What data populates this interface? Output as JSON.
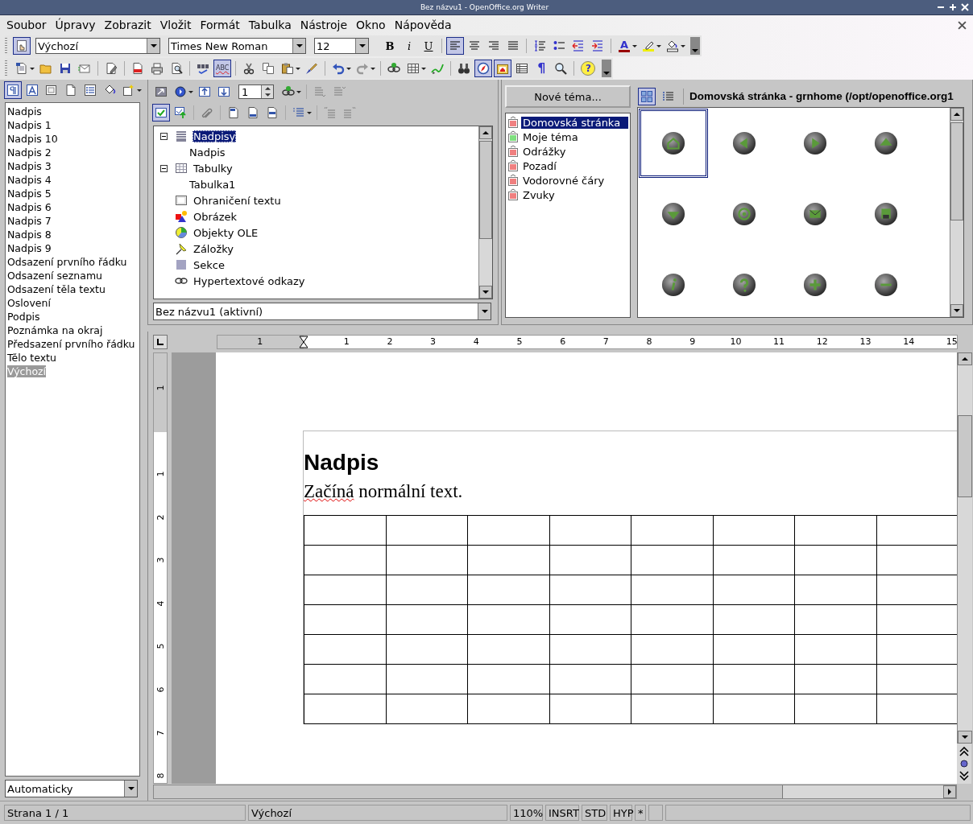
{
  "window": {
    "title": "Bez názvu1 - OpenOffice.org Writer"
  },
  "menu": [
    "Soubor",
    "Úpravy",
    "Zobrazit",
    "Vložit",
    "Formát",
    "Tabulka",
    "Nástroje",
    "Okno",
    "Nápověda"
  ],
  "formatting_toolbar": {
    "stylist": {
      "on": true
    },
    "style": "Výchozí",
    "font": "Times New Roman",
    "size": "12",
    "items": [
      {
        "kind": "bold",
        "label": "B",
        "on": false
      },
      {
        "kind": "italic",
        "label": "i",
        "on": false
      },
      {
        "kind": "underline",
        "label": "U",
        "on": false
      },
      {
        "kind": "separator"
      },
      {
        "kind": "align-left",
        "on": true
      },
      {
        "kind": "align-center",
        "on": false
      },
      {
        "kind": "align-right",
        "on": false
      },
      {
        "kind": "justify",
        "on": false
      },
      {
        "kind": "separator"
      },
      {
        "kind": "numbering",
        "on": false
      },
      {
        "kind": "bullets",
        "on": false
      },
      {
        "kind": "outdent",
        "on": false
      },
      {
        "kind": "indent",
        "on": false
      },
      {
        "kind": "separator"
      },
      {
        "kind": "font-color",
        "label": "A",
        "on": false
      },
      {
        "kind": "dropdown-arrow"
      },
      {
        "kind": "highlight",
        "on": false
      },
      {
        "kind": "dropdown-arrow"
      },
      {
        "kind": "background",
        "on": false
      },
      {
        "kind": "dropdown-arrow"
      },
      {
        "kind": "overflow"
      }
    ]
  },
  "standard_toolbar": [
    {
      "kind": "new",
      "on": false
    },
    {
      "kind": "dropdown-arrow"
    },
    {
      "kind": "open",
      "on": false
    },
    {
      "kind": "save",
      "on": false
    },
    {
      "kind": "email",
      "on": false
    },
    {
      "kind": "separator"
    },
    {
      "kind": "edit",
      "on": false
    },
    {
      "kind": "separator"
    },
    {
      "kind": "pdf",
      "on": false
    },
    {
      "kind": "print",
      "on": false
    },
    {
      "kind": "preview",
      "on": false
    },
    {
      "kind": "separator"
    },
    {
      "kind": "spellcheck",
      "on": false
    },
    {
      "kind": "autospell",
      "label": "ABC",
      "on": true
    },
    {
      "kind": "separator"
    },
    {
      "kind": "cut",
      "on": false
    },
    {
      "kind": "copy",
      "on": false
    },
    {
      "kind": "paste",
      "on": false
    },
    {
      "kind": "dropdown-arrow"
    },
    {
      "kind": "brush",
      "on": false
    },
    {
      "kind": "separator"
    },
    {
      "kind": "undo",
      "on": false
    },
    {
      "kind": "dropdown-arrow"
    },
    {
      "kind": "redo",
      "on": false
    },
    {
      "kind": "dropdown-arrow"
    },
    {
      "kind": "separator"
    },
    {
      "kind": "hyperlink",
      "on": false
    },
    {
      "kind": "table",
      "on": false
    },
    {
      "kind": "dropdown-arrow"
    },
    {
      "kind": "draw",
      "on": false
    },
    {
      "kind": "separator"
    },
    {
      "kind": "find",
      "on": false
    },
    {
      "kind": "navigator",
      "on": true
    },
    {
      "kind": "gallery",
      "on": true
    },
    {
      "kind": "datasource",
      "on": false
    },
    {
      "kind": "formatting-marks",
      "label": "¶",
      "on": false
    },
    {
      "kind": "zoom",
      "on": false
    },
    {
      "kind": "separator"
    },
    {
      "kind": "help",
      "label": "?",
      "on": false
    },
    {
      "kind": "overflow"
    }
  ],
  "styles_panel": {
    "toolbar": [
      {
        "kind": "paragraph-styles",
        "on": true
      },
      {
        "kind": "character-styles",
        "on": false
      },
      {
        "kind": "frame-styles",
        "on": false
      },
      {
        "kind": "page-styles",
        "on": false
      },
      {
        "kind": "list-styles",
        "on": false
      },
      {
        "kind": "fill-format",
        "on": false
      },
      {
        "kind": "new-style",
        "on": false
      },
      {
        "kind": "dropdown-arrow"
      }
    ],
    "styles": [
      {
        "label": "Nadpis",
        "selected": false
      },
      {
        "label": "Nadpis 1",
        "selected": false
      },
      {
        "label": "Nadpis 10",
        "selected": false
      },
      {
        "label": "Nadpis 2",
        "selected": false
      },
      {
        "label": "Nadpis 3",
        "selected": false
      },
      {
        "label": "Nadpis 4",
        "selected": false
      },
      {
        "label": "Nadpis 5",
        "selected": false
      },
      {
        "label": "Nadpis 6",
        "selected": false
      },
      {
        "label": "Nadpis 7",
        "selected": false
      },
      {
        "label": "Nadpis 8",
        "selected": false
      },
      {
        "label": "Nadpis 9",
        "selected": false
      },
      {
        "label": "Odsazení prvního řádku",
        "selected": false
      },
      {
        "label": "Odsazení seznamu",
        "selected": false
      },
      {
        "label": "Odsazení těla textu",
        "selected": false
      },
      {
        "label": "Oslovení",
        "selected": false
      },
      {
        "label": "Podpis",
        "selected": false
      },
      {
        "label": "Poznámka na okraj",
        "selected": false
      },
      {
        "label": "Předsazení prvního řádku",
        "selected": false
      },
      {
        "label": "Tělo textu",
        "selected": false
      },
      {
        "label": "Výchozí",
        "selected": true
      }
    ],
    "filter": "Automaticky"
  },
  "navigator": {
    "toolbar_1": [
      {
        "kind": "content-view",
        "on": false
      },
      {
        "kind": "navigation",
        "on": false
      },
      {
        "kind": "dropdown-arrow"
      },
      {
        "kind": "prev-object",
        "on": false
      },
      {
        "kind": "next-object",
        "on": false
      },
      {
        "kind": "page-spin",
        "value": "1"
      },
      {
        "kind": "hyperlink",
        "on": false
      },
      {
        "kind": "dropdown-arrow"
      },
      {
        "kind": "separator"
      },
      {
        "kind": "promote-chapter",
        "on": false
      },
      {
        "kind": "demote-chapter",
        "on": false
      }
    ],
    "toolbar_2": [
      {
        "kind": "list-box",
        "on": true
      },
      {
        "kind": "drag-mode",
        "on": false
      },
      {
        "kind": "separator"
      },
      {
        "kind": "reminder",
        "on": false
      },
      {
        "kind": "separator"
      },
      {
        "kind": "header",
        "on": false
      },
      {
        "kind": "footer",
        "on": false
      },
      {
        "kind": "anchor",
        "on": false
      },
      {
        "kind": "separator"
      },
      {
        "kind": "heading-levels",
        "on": false
      },
      {
        "kind": "dropdown-arrow"
      },
      {
        "kind": "separator"
      },
      {
        "kind": "promote-level",
        "on": false
      },
      {
        "kind": "demote-level",
        "on": false
      }
    ],
    "tree": [
      {
        "label": "Nadpisy",
        "kind": "headings",
        "expanded": true,
        "selected": true,
        "children": [
          {
            "label": "Nadpis",
            "selected": false
          }
        ]
      },
      {
        "label": "Tabulky",
        "kind": "tables",
        "expanded": true,
        "selected": false,
        "children": [
          {
            "label": "Tabulka1",
            "selected": false
          }
        ]
      },
      {
        "label": "Ohraničení textu",
        "kind": "frames",
        "selected": false
      },
      {
        "label": "Obrázek",
        "kind": "images",
        "selected": false
      },
      {
        "label": "Objekty OLE",
        "kind": "ole",
        "selected": false
      },
      {
        "label": "Záložky",
        "kind": "bookmarks",
        "selected": false
      },
      {
        "label": "Sekce",
        "kind": "sections",
        "selected": false
      },
      {
        "label": "Hypertextové odkazy",
        "kind": "hyperlinks",
        "selected": false
      }
    ],
    "document": "Bez názvu1 (aktivní)"
  },
  "gallery": {
    "new_theme": "Nové téma...",
    "themes": [
      {
        "label": "Domovská stránka",
        "selected": true,
        "color": "#f08080"
      },
      {
        "label": "Moje téma",
        "selected": false,
        "color": "#80e080"
      },
      {
        "label": "Odrážky",
        "selected": false,
        "color": "#f08080"
      },
      {
        "label": "Pozadí",
        "selected": false,
        "color": "#f08080"
      },
      {
        "label": "Vodorovné čáry",
        "selected": false,
        "color": "#f08080"
      },
      {
        "label": "Zvuky",
        "selected": false,
        "color": "#f08080"
      }
    ],
    "view_modes": [
      {
        "kind": "icons",
        "selected": true
      },
      {
        "kind": "details",
        "selected": false
      }
    ],
    "title": "Domovská stránka - grnhome (/opt/openoffice.org1",
    "items": [
      {
        "kind": "home",
        "selected": true
      },
      {
        "kind": "left",
        "selected": false
      },
      {
        "kind": "right",
        "selected": false
      },
      {
        "kind": "up",
        "selected": false
      },
      {
        "kind": "down",
        "selected": false
      },
      {
        "kind": "at",
        "selected": false
      },
      {
        "kind": "mail",
        "selected": false
      },
      {
        "kind": "disk",
        "selected": false
      },
      {
        "kind": "info",
        "selected": false
      },
      {
        "kind": "question",
        "selected": false
      },
      {
        "kind": "plus",
        "selected": false
      },
      {
        "kind": "minus",
        "selected": false
      }
    ]
  },
  "ruler": {
    "horizontal": [
      "1",
      "1",
      "2",
      "3",
      "4",
      "5",
      "6",
      "7",
      "8",
      "9",
      "10",
      "11",
      "12",
      "13",
      "14",
      "15"
    ],
    "vertical": [
      "1",
      "1",
      "2",
      "3",
      "4",
      "5",
      "6",
      "7",
      "8"
    ]
  },
  "document": {
    "heading": "Nadpis",
    "paragraph": [
      {
        "text": "Začíná",
        "misspelled": true
      },
      {
        "text": " normální text.",
        "misspelled": false
      }
    ]
  },
  "status_bar": [
    "Strana 1 / 1",
    "Výchozí",
    "110%",
    "INSRT",
    "STD",
    "HYP",
    "*"
  ]
}
